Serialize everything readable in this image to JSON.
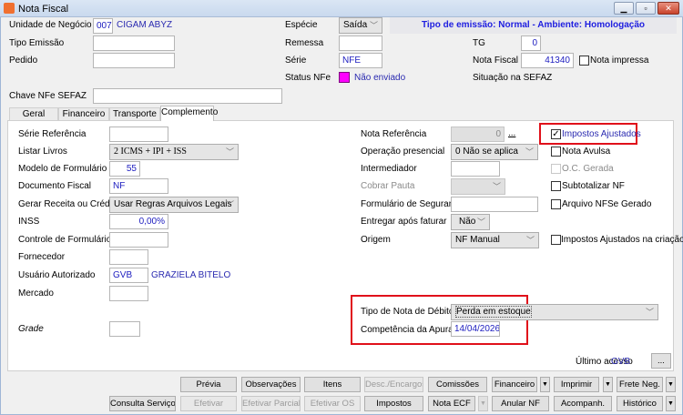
{
  "window": {
    "title": "Nota Fiscal",
    "minimize": "▁",
    "maximize": "▫",
    "close": "✕"
  },
  "header": {
    "unidade_label": "Unidade de Negócio",
    "unidade_code": "007",
    "unidade_name": "CIGAM ABYZ",
    "tipo_emissao_label": "Tipo Emissão",
    "tipo_emissao_value": "",
    "pedido_label": "Pedido",
    "pedido_value": "",
    "chave_label": "Chave NFe SEFAZ",
    "chave_value": "",
    "especie_label": "Espécie",
    "especie_value": "Saída",
    "banner": "Tipo de emissão: Normal - Ambiente: Homologação",
    "remessa_label": "Remessa",
    "remessa_value": "",
    "serie_label": "Série",
    "serie_value": "NFE",
    "status_label": "Status NFe",
    "status_value": "Não enviado",
    "status_color": "#ff00ff",
    "tg_label": "TG",
    "tg_value": "0",
    "nota_label": "Nota Fiscal",
    "nota_value": "41340",
    "nota_impressa_label": "Nota impressa",
    "nota_impressa_checked": false,
    "situacao_label": "Situação na SEFAZ"
  },
  "tabs": [
    {
      "label": "Geral"
    },
    {
      "label": "Financeiro"
    },
    {
      "label": "Transporte"
    },
    {
      "label": "Complemento",
      "active": true
    }
  ],
  "left": [
    {
      "label": "Série Referência",
      "value": ""
    },
    {
      "label": "Listar Livros",
      "value": "2 ICMS + IPI + ISS"
    },
    {
      "label": "Modelo de Formulário",
      "value": "55"
    },
    {
      "label": "Documento Fiscal",
      "value": "NF"
    },
    {
      "label": "Gerar Receita ou Crédito",
      "value": "Usar Regras Arquivos Legais"
    },
    {
      "label": "INSS",
      "value": "0,00%"
    },
    {
      "label": "Controle de Formulário",
      "value": ""
    },
    {
      "label": "Fornecedor",
      "value": ""
    },
    {
      "label": "Usuário Autorizado",
      "value": "GVB",
      "extra": "GRAZIELA BITELO"
    },
    {
      "label": "Mercado",
      "value": ""
    },
    {
      "label": "Grade",
      "value": ""
    }
  ],
  "right": [
    {
      "label": "Nota Referência",
      "value": "0",
      "extra": "..."
    },
    {
      "label": "Operação presencial",
      "value": "0 Não se aplica"
    },
    {
      "label": "Intermediador",
      "value": ""
    },
    {
      "label": "Cobrar Pauta",
      "value": ""
    },
    {
      "label": "Formulário de Segurança",
      "value": ""
    },
    {
      "label": "Entregar após faturar",
      "value": "Não"
    },
    {
      "label": "Origem",
      "value": "NF Manual"
    }
  ],
  "checks": [
    {
      "label": "Impostos Ajustados",
      "checked": true
    },
    {
      "label": "Nota Avulsa",
      "checked": false
    },
    {
      "label": "O.C. Gerada",
      "checked": false,
      "disabled": true
    },
    {
      "label": "Subtotalizar NF",
      "checked": false
    },
    {
      "label": "Arquivo NFSe Gerado",
      "checked": false
    },
    {
      "label": "Impostos Ajustados na criação",
      "checked": false
    }
  ],
  "debito": {
    "tipo_label": "Tipo de Nota de Débito",
    "tipo_value": "Perda em estoque",
    "comp_label": "Competência da Apuração",
    "comp_value": "14/04/2026"
  },
  "ultimo": {
    "label": "Último acesso",
    "value": "GVB",
    "button": "..."
  },
  "buttons_row1": [
    "Prévia",
    "Observações",
    "Itens",
    "Desc./Encargos",
    "Comissões",
    "Financeiro",
    "Imprimir",
    "Frete Neg."
  ],
  "buttons_row2": [
    "Consulta Serviços",
    "Efetivar",
    "Efetivar Parcial",
    "Efetivar OS",
    "Impostos",
    "Nota ECF",
    "Anular NF",
    "Acompanh.",
    "Histórico"
  ],
  "chev": "﹀",
  "arrow": "▼",
  "check": "✓"
}
